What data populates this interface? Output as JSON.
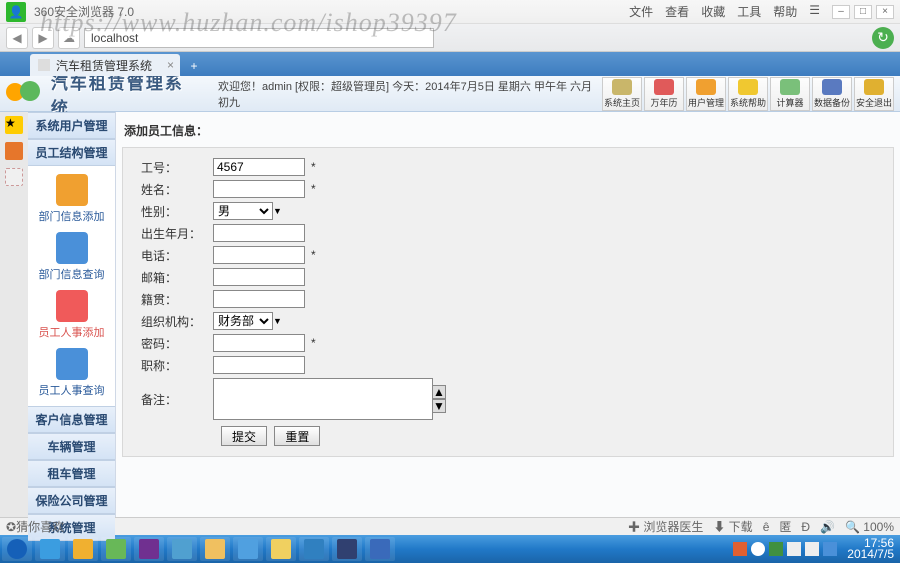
{
  "watermark": "https://www.huzhan.com/ishop39397",
  "browser": {
    "title": "360安全浏览器 7.0",
    "menu": [
      "文件",
      "查看",
      "收藏",
      "工具",
      "帮助"
    ],
    "url": "localhost",
    "tab_title": "汽车租赁管理系统"
  },
  "app": {
    "title": "汽车租赁管理系统",
    "welcome": "欢迎您！admin [权限：超级管理员] 今天：2014年7月5日 星期六 甲午年 六月初九",
    "toolbar": [
      {
        "name": "home",
        "label": "系统主页",
        "color": "#c9b66a"
      },
      {
        "name": "calendar",
        "label": "万年历",
        "color": "#e05a5a"
      },
      {
        "name": "users",
        "label": "用户管理",
        "color": "#f0a030"
      },
      {
        "name": "help",
        "label": "系统帮助",
        "color": "#f0c830"
      },
      {
        "name": "calc",
        "label": "计算器",
        "color": "#7ac07a"
      },
      {
        "name": "backup",
        "label": "数据备份",
        "color": "#5a7ac0"
      },
      {
        "name": "exit",
        "label": "安全退出",
        "color": "#e0b030"
      }
    ]
  },
  "sidebar": {
    "group_top": [
      "系统用户管理",
      "员工结构管理"
    ],
    "navitems": [
      {
        "name": "dept-add",
        "label": "部门信息添加",
        "color": "#f0a030"
      },
      {
        "name": "dept-query",
        "label": "部门信息查询",
        "color": "#4a90d9"
      },
      {
        "name": "emp-add",
        "label": "员工人事添加",
        "color": "#f05a5a",
        "active": true
      },
      {
        "name": "emp-query",
        "label": "员工人事查询",
        "color": "#4a90d9"
      }
    ],
    "group_bottom": [
      "客户信息管理",
      "车辆管理",
      "租车管理",
      "保险公司管理",
      "系统管理"
    ]
  },
  "form": {
    "title": "添加员工信息：",
    "fields": {
      "empno": {
        "label": "工号：",
        "value": "4567",
        "type": "text",
        "req": true
      },
      "name": {
        "label": "姓名：",
        "value": "",
        "type": "text",
        "req": true
      },
      "gender": {
        "label": "性别：",
        "value": "男",
        "type": "select"
      },
      "birth": {
        "label": "出生年月：",
        "value": "",
        "type": "text"
      },
      "phone": {
        "label": "电话：",
        "value": "",
        "type": "text",
        "req": true
      },
      "email": {
        "label": "邮箱：",
        "value": "",
        "type": "text"
      },
      "origin": {
        "label": "籍贯：",
        "value": "",
        "type": "text"
      },
      "org": {
        "label": "组织机构：",
        "value": "财务部",
        "type": "select"
      },
      "password": {
        "label": "密码：",
        "value": "",
        "type": "password",
        "req": true
      },
      "title": {
        "label": "职称：",
        "value": "",
        "type": "text"
      },
      "remark": {
        "label": "备注：",
        "value": "",
        "type": "textarea"
      }
    },
    "buttons": {
      "submit": "提交",
      "reset": "重置"
    }
  },
  "statusbar": {
    "left": "猜你喜欢",
    "items": [
      "浏览器医生",
      "下载",
      "ê",
      "匿",
      "Ð",
      "100%"
    ]
  },
  "taskbar": {
    "apps": [
      "start",
      "ie",
      "browser",
      "chrome",
      "media",
      "safari",
      "folder",
      "qq",
      "find",
      "globe",
      "s",
      "word"
    ],
    "clock": {
      "time": "17:56",
      "date": "2014/7/5"
    }
  }
}
